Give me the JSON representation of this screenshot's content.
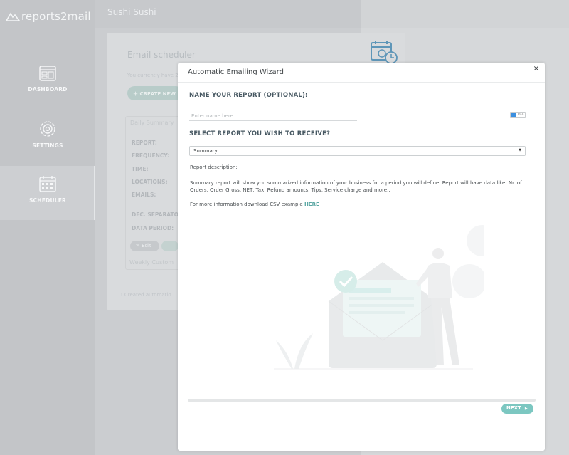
{
  "app": {
    "logo_text": "reports2mail"
  },
  "sidebar": {
    "items": [
      {
        "label": "DASHBOARD",
        "icon": "dashboard-icon"
      },
      {
        "label": "SETTINGS",
        "icon": "settings-icon"
      },
      {
        "label": "SCHEDULER",
        "icon": "calendar-icon",
        "active": true
      }
    ]
  },
  "header": {
    "restaurant": "Sushi Sushi"
  },
  "background": {
    "card_title": "Email scheduler",
    "card_sub": "You currently have 2",
    "create_button": "CREATE NEW",
    "schedule_name": "Daily Summary",
    "fields": [
      "REPORT:",
      "FREQUENCY:",
      "TIME:",
      "LOCATIONS:",
      "EMAILS:",
      "DEC. SEPARATOR",
      "DATA PERIOD:"
    ],
    "edit_label": "Edit",
    "weekly_name": "Weekly Custom",
    "created_note": "Created automatio"
  },
  "modal": {
    "title": "Automatic Emailing Wizard",
    "close": "×",
    "name_heading": "NAME YOUR REPORT (OPTIONAL):",
    "name_placeholder": "Enter name here",
    "name_value": "",
    "toggle_label": "OFF",
    "select_heading": "SELECT REPORT YOU WISH TO RECEIVE?",
    "selected_report": "Summary",
    "desc_label": "Report description:",
    "desc_text": "Summary report will show you summarized information of your business for a period you will define. Report will have data like: Nr. of Orders, Order Gross, NET, Tax, Refund amounts, Tips, Service charge and more..",
    "more_info": "For more information download CSV example",
    "here_link": "HERE",
    "progress": 0.0,
    "next_label": "NEXT"
  },
  "colors": {
    "accent": "#7cc7c1",
    "link": "#5aa7a3",
    "heading": "#475862"
  }
}
